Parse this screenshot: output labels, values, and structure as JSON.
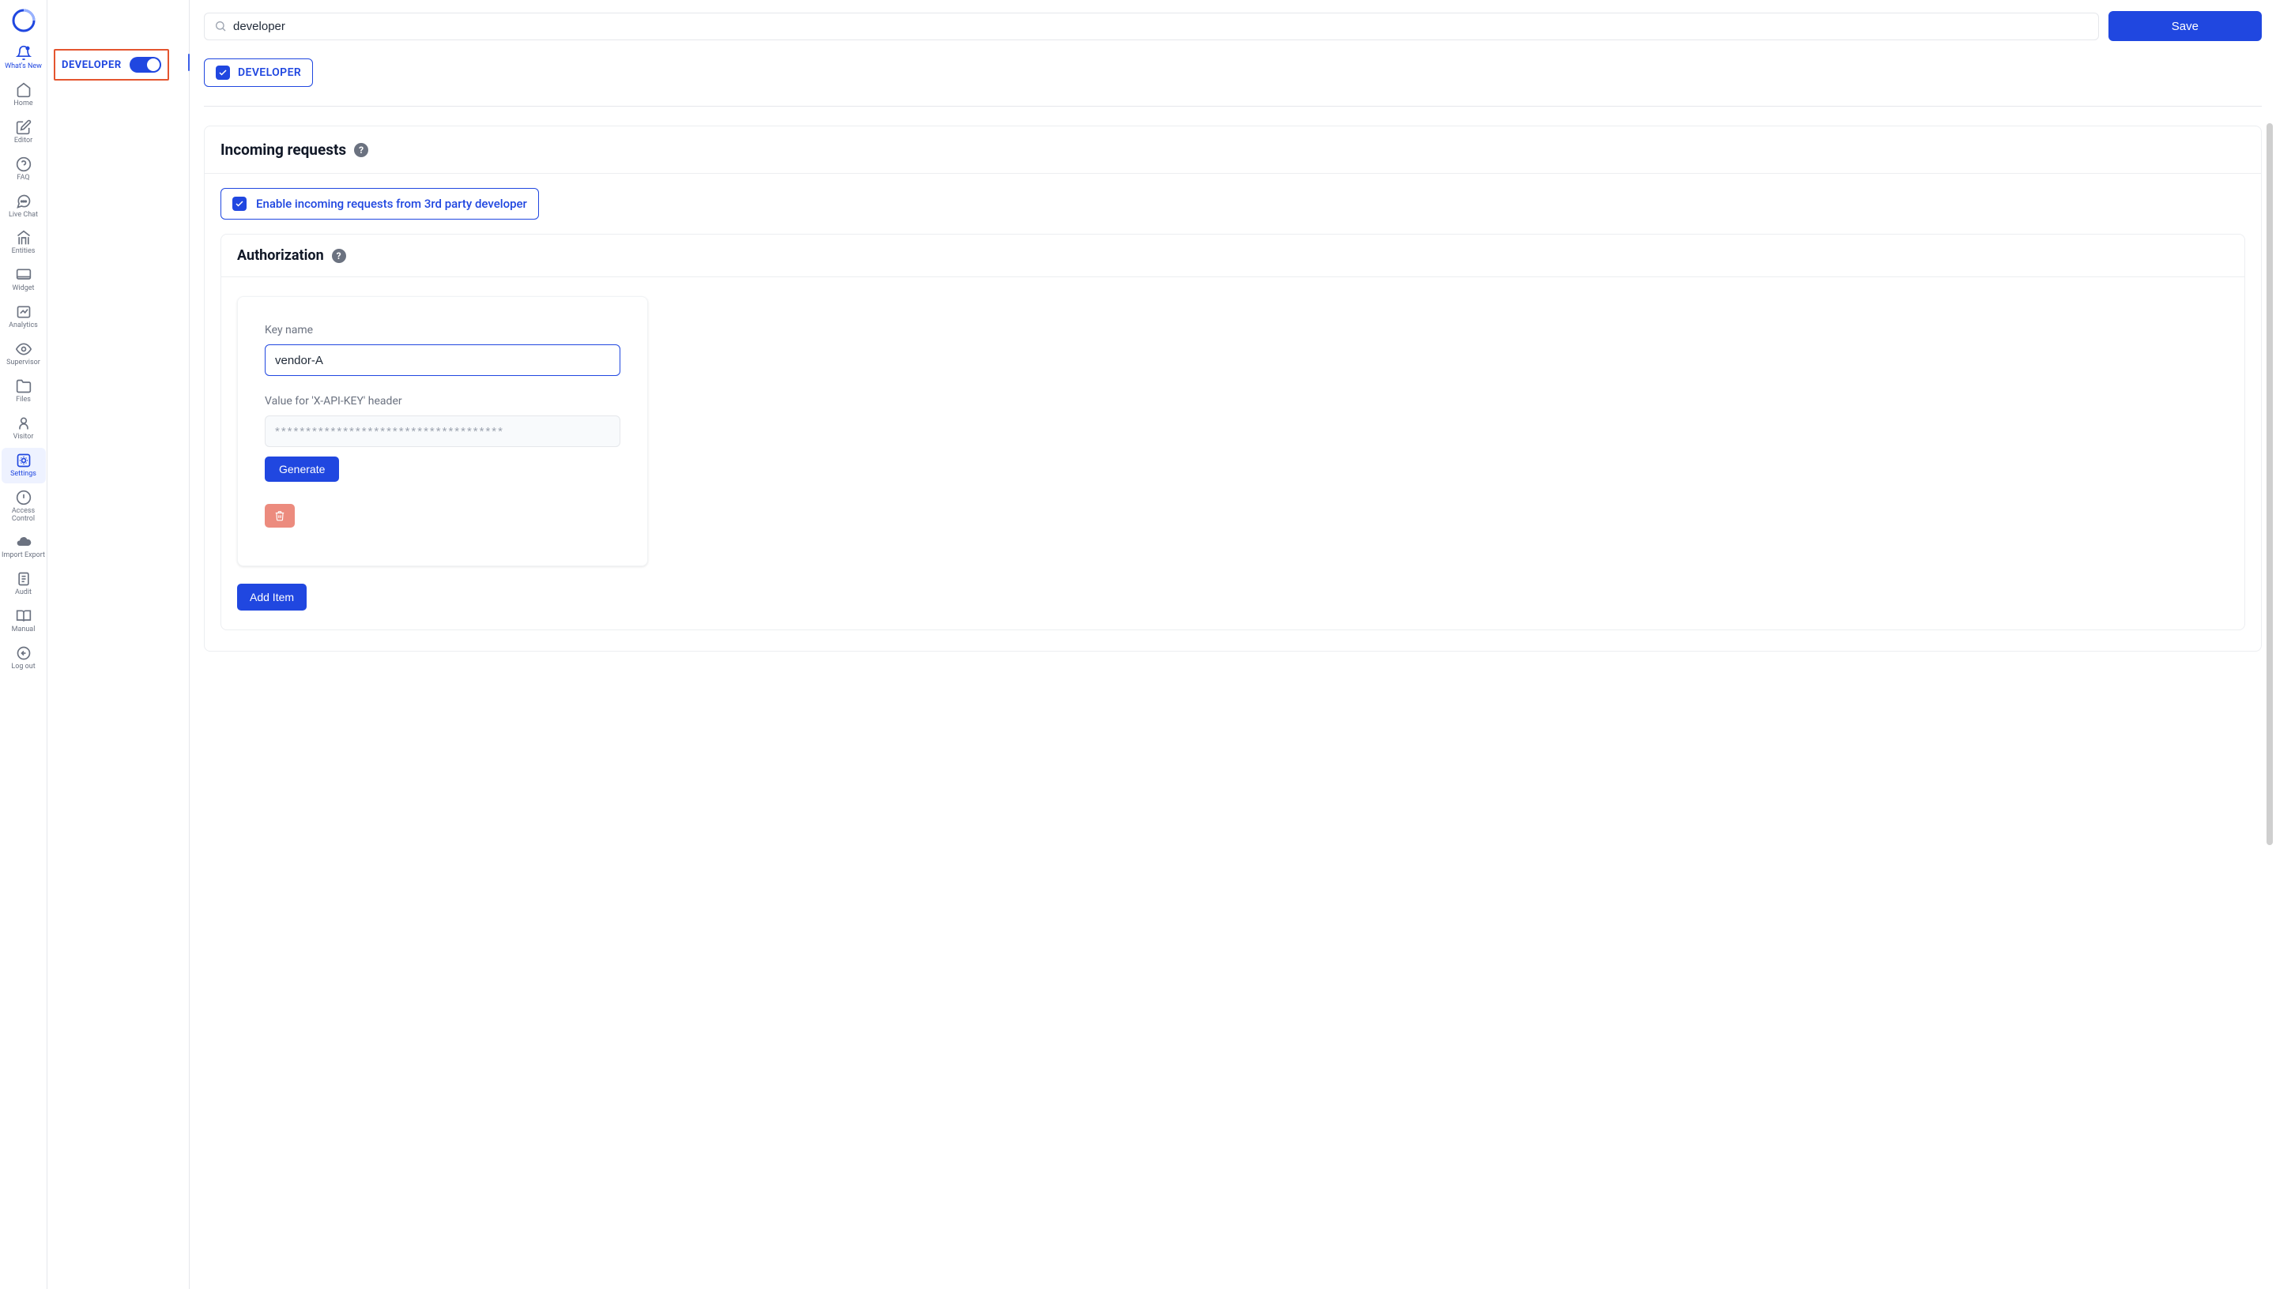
{
  "sidebar": {
    "logo_color": "#2047e0",
    "items": [
      {
        "id": "whatsnew",
        "label": "What's New",
        "icon": "bell-dot-icon"
      },
      {
        "id": "home",
        "label": "Home",
        "icon": "home-icon"
      },
      {
        "id": "editor",
        "label": "Editor",
        "icon": "edit-icon"
      },
      {
        "id": "faq",
        "label": "FAQ",
        "icon": "help-circle-icon"
      },
      {
        "id": "livechat",
        "label": "Live Chat",
        "icon": "message-bubble-icon"
      },
      {
        "id": "entities",
        "label": "Entities",
        "icon": "house-entities-icon"
      },
      {
        "id": "widget",
        "label": "Widget",
        "icon": "monitor-icon"
      },
      {
        "id": "analytics",
        "label": "Analytics",
        "icon": "chart-icon"
      },
      {
        "id": "supervisor",
        "label": "Supervisor",
        "icon": "eye-icon"
      },
      {
        "id": "files",
        "label": "Files",
        "icon": "folder-icon"
      },
      {
        "id": "visitor",
        "label": "Visitor",
        "icon": "user-icon"
      },
      {
        "id": "settings",
        "label": "Settings",
        "icon": "settings-square-icon"
      },
      {
        "id": "accesscontrol",
        "label": "Access Control",
        "icon": "alert-circle-icon"
      },
      {
        "id": "importexport",
        "label": "Import Export",
        "icon": "cloud-upload-icon"
      },
      {
        "id": "audit",
        "label": "Audit",
        "icon": "audit-icon"
      },
      {
        "id": "manual",
        "label": "Manual",
        "icon": "book-icon"
      },
      {
        "id": "logout",
        "label": "Log out",
        "icon": "logout-icon"
      }
    ],
    "active_id": "settings",
    "highlight_id": "whatsnew"
  },
  "secondary": {
    "developer_label": "DEVELOPER",
    "developer_toggle_on": true
  },
  "topbar": {
    "search_value": "developer",
    "save_label": "Save"
  },
  "tag": {
    "label": "DEVELOPER",
    "checked": true
  },
  "incoming": {
    "title": "Incoming requests",
    "enable_label": "Enable incoming requests from 3rd party developer",
    "enable_checked": true
  },
  "authorization": {
    "title": "Authorization",
    "key_name_label": "Key name",
    "key_name_value": "vendor-A",
    "api_key_label": "Value for 'X-API-KEY' header",
    "api_key_value": "*************************************",
    "generate_label": "Generate",
    "add_item_label": "Add Item"
  },
  "colors": {
    "primary": "#2047e0",
    "highlight_border": "#e4552f",
    "danger_soft": "#ec8b7e"
  }
}
